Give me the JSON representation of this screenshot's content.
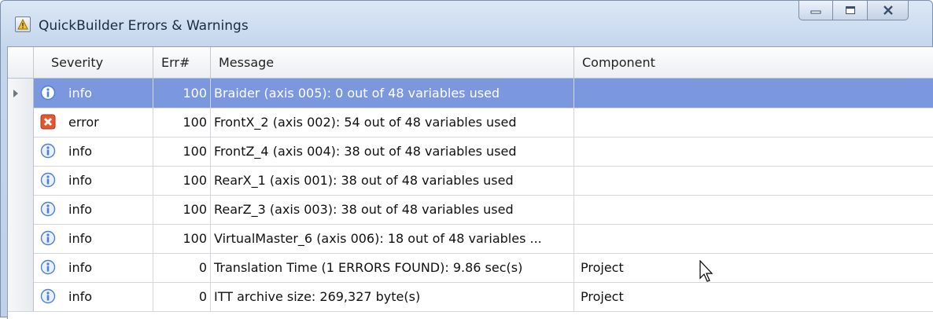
{
  "window": {
    "title": "QuickBuilder Errors & Warnings",
    "icon": "warning-icon"
  },
  "columns": [
    "Severity",
    "Err#",
    "Message",
    "Component"
  ],
  "rows": [
    {
      "severity": "info",
      "icon": "info-icon",
      "err": "100",
      "message": "Braider (axis 005): 0 out of 48 variables used",
      "component": "",
      "selected": true
    },
    {
      "severity": "error",
      "icon": "error-icon",
      "err": "100",
      "message": "FrontX_2 (axis 002): 54 out of 48 variables used",
      "component": ""
    },
    {
      "severity": "info",
      "icon": "info-icon",
      "err": "100",
      "message": "FrontZ_4 (axis 004): 38 out of 48 variables used",
      "component": ""
    },
    {
      "severity": "info",
      "icon": "info-icon",
      "err": "100",
      "message": "RearX_1 (axis 001): 38 out of 48 variables used",
      "component": ""
    },
    {
      "severity": "info",
      "icon": "info-icon",
      "err": "100",
      "message": "RearZ_3 (axis 003): 38 out of 48 variables used",
      "component": ""
    },
    {
      "severity": "info",
      "icon": "info-icon",
      "err": "100",
      "message": "VirtualMaster_6 (axis 006): 18 out of 48 variables ...",
      "component": ""
    },
    {
      "severity": "info",
      "icon": "info-icon",
      "err": "0",
      "message": "Translation Time (1 ERRORS FOUND): 9.86 sec(s)",
      "component": "Project"
    },
    {
      "severity": "info",
      "icon": "info-icon",
      "err": "0",
      "message": "ITT archive size: 269,327 byte(s)",
      "component": "Project"
    }
  ],
  "colors": {
    "selection": "#7b98df",
    "error_icon": "#e4572e",
    "info_icon": "#4c7fd6"
  }
}
